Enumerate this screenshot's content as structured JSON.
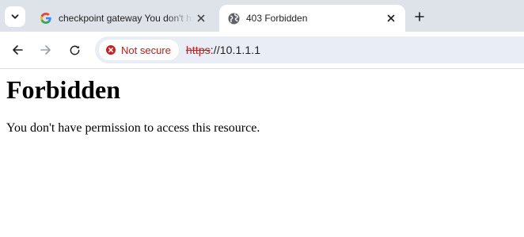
{
  "tabs": [
    {
      "title": "checkpoint gateway You don't have permission",
      "favicon": "google-g-icon",
      "active": false
    },
    {
      "title": "403 Forbidden",
      "favicon": "globe-icon",
      "active": true
    }
  ],
  "toolbar": {
    "security_label": "Not secure",
    "url_scheme": "https",
    "url_rest": "://10.1.1.1"
  },
  "page": {
    "heading": "Forbidden",
    "message": "You don't have permission to access this resource."
  },
  "colors": {
    "tabstrip_bg": "#dee3ea",
    "omnibox_bg": "#e9eef6",
    "warning_red": "#c5221f"
  }
}
